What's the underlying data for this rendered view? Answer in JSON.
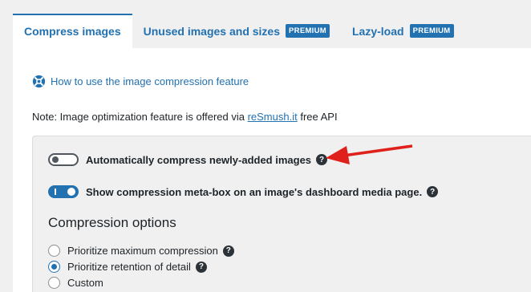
{
  "tabs": [
    {
      "label": "Compress images",
      "active": true
    },
    {
      "label": "Unused images and sizes",
      "badge": "PREMIUM"
    },
    {
      "label": "Lazy-load",
      "badge": "PREMIUM"
    }
  ],
  "help_link": {
    "label": "How to use the image compression feature",
    "icon": "lifebuoy-icon"
  },
  "note": {
    "prefix": "Note: Image optimization feature is offered via ",
    "link": "reSmush.it",
    "suffix": " free API"
  },
  "settings": {
    "auto_compress": {
      "label": "Automatically compress newly-added images",
      "enabled": false
    },
    "meta_box": {
      "label": "Show compression meta-box on an image's dashboard media page.",
      "enabled": true
    },
    "section_title": "Compression options",
    "options": [
      {
        "label": "Prioritize maximum compression",
        "checked": false,
        "help": true
      },
      {
        "label": "Prioritize retention of detail",
        "checked": true,
        "help": true
      },
      {
        "label": "Custom",
        "checked": false,
        "help": false
      }
    ]
  },
  "colors": {
    "accent": "#2271b1",
    "annotation_arrow": "#e0201b"
  }
}
